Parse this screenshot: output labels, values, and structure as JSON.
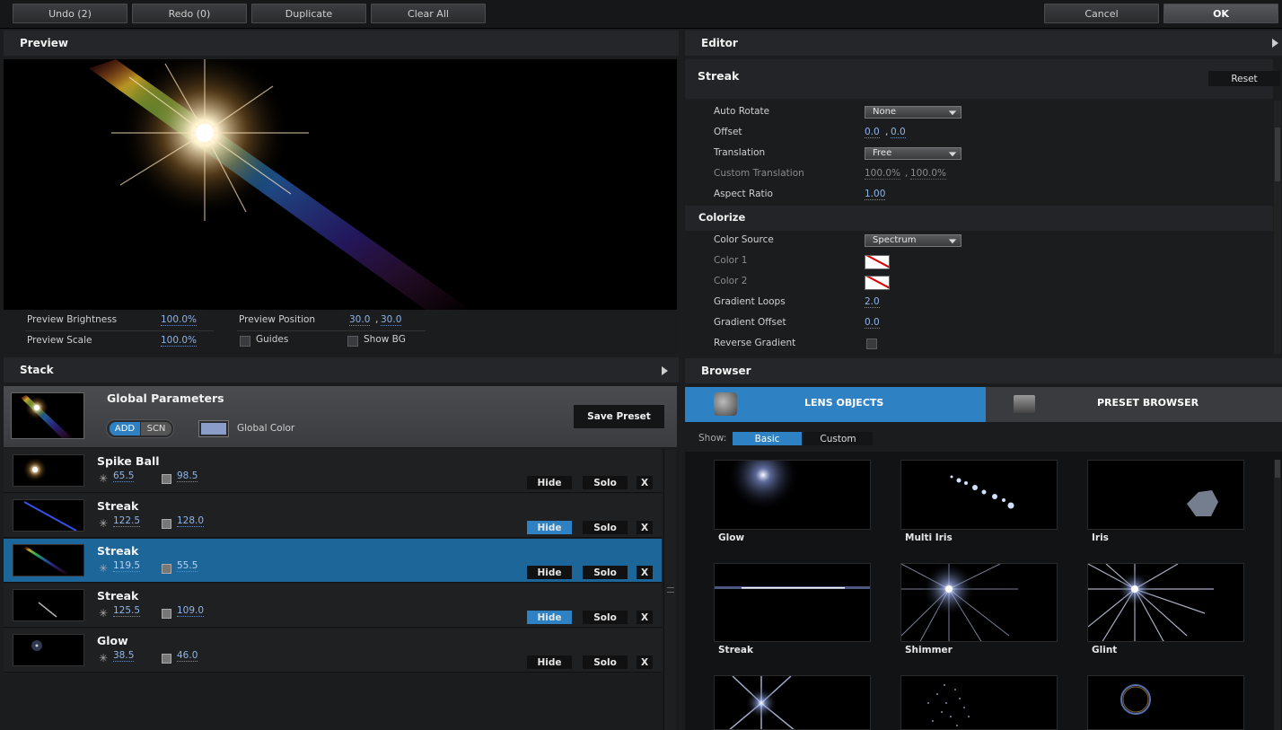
{
  "toolbar": {
    "undo": "Undo (2)",
    "redo": "Redo (0)",
    "duplicate": "Duplicate",
    "clear_all": "Clear All",
    "cancel": "Cancel",
    "ok": "OK"
  },
  "preview": {
    "title": "Preview",
    "brightness_label": "Preview Brightness",
    "brightness_value": "100.0%",
    "scale_label": "Preview Scale",
    "scale_value": "100.0%",
    "position_label": "Preview Position",
    "position_x": "30.0",
    "position_y": "30.0",
    "guides_label": "Guides",
    "show_bg_label": "Show BG"
  },
  "editor": {
    "title": "Editor",
    "section": "Streak",
    "reset": "Reset",
    "auto_rotate_label": "Auto Rotate",
    "auto_rotate_value": "None",
    "offset_label": "Offset",
    "offset_x": "0.0",
    "offset_y": "0.0",
    "translation_label": "Translation",
    "translation_value": "Free",
    "custom_translation_label": "Custom Translation",
    "custom_translation_x": "100.0%",
    "custom_translation_y": "100.0%",
    "aspect_ratio_label": "Aspect Ratio",
    "aspect_ratio_value": "1.00",
    "colorize_title": "Colorize",
    "color_source_label": "Color Source",
    "color_source_value": "Spectrum",
    "color1_label": "Color 1",
    "color2_label": "Color 2",
    "gradient_loops_label": "Gradient Loops",
    "gradient_loops_value": "2.0",
    "gradient_offset_label": "Gradient Offset",
    "gradient_offset_value": "0.0",
    "reverse_gradient_label": "Reverse Gradient"
  },
  "stack": {
    "title": "Stack",
    "global_title": "Global Parameters",
    "add": "ADD",
    "scn": "SCN",
    "global_color": "Global Color",
    "save_preset": "Save Preset",
    "hide": "Hide",
    "solo": "Solo",
    "x": "X",
    "items": [
      {
        "name": "Spike Ball",
        "v1": "65.5",
        "v2": "98.5"
      },
      {
        "name": "Streak",
        "v1": "122.5",
        "v2": "128.0"
      },
      {
        "name": "Streak",
        "v1": "119.5",
        "v2": "55.5"
      },
      {
        "name": "Streak",
        "v1": "125.5",
        "v2": "109.0"
      },
      {
        "name": "Glow",
        "v1": "38.5",
        "v2": "46.0"
      }
    ]
  },
  "browser": {
    "title": "Browser",
    "lens_objects": "LENS OBJECTS",
    "preset_browser": "PRESET BROWSER",
    "show": "Show:",
    "basic": "Basic",
    "custom": "Custom",
    "items": [
      "Glow",
      "Multi Iris",
      "Iris",
      "Streak",
      "Shimmer",
      "Glint"
    ]
  }
}
